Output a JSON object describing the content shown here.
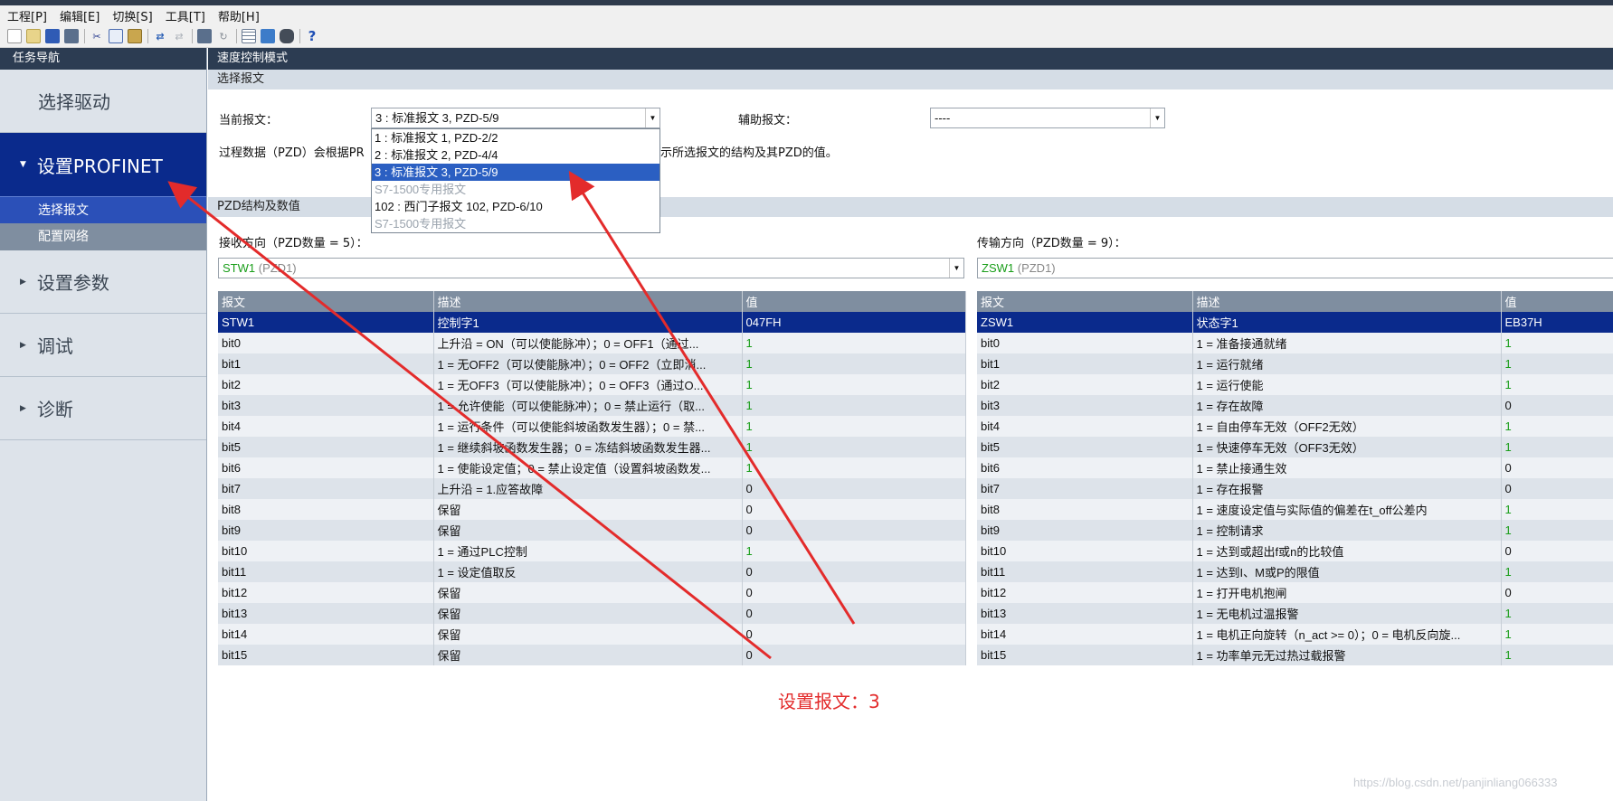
{
  "menu": [
    "工程[P]",
    "编辑[E]",
    "切换[S]",
    "工具[T]",
    "帮助[H]"
  ],
  "toolbar_icons": [
    "new-icon",
    "open-icon",
    "save-icon",
    "print-icon",
    "cut-icon",
    "copy-icon",
    "paste-icon",
    "connect-icon",
    "disconnect-icon",
    "download-icon",
    "upload-icon",
    "table-icon",
    "chart-icon",
    "device-icon",
    "help-icon"
  ],
  "nav": {
    "header": "任务导航",
    "items": [
      {
        "label": "选择驱动"
      },
      {
        "label": "设置PROFINET"
      },
      {
        "label": "设置参数"
      },
      {
        "label": "调试"
      },
      {
        "label": "诊断"
      }
    ],
    "subitems": [
      "选择报文",
      "配置网络"
    ]
  },
  "main": {
    "title": "速度控制模式",
    "section1": "选择报文",
    "current_label": "当前报文：",
    "current_value": "3 : 标准报文 3, PZD-5/9",
    "aux_label": "辅助报文：",
    "aux_value": "----",
    "description_left": "过程数据（PZD）会根据PR",
    "description_right": "示所选报文的结构及其PZD的值。",
    "section2": "PZD结构及数值",
    "dropdown_options": [
      "1 : 标准报文 1, PZD-2/2",
      "2 : 标准报文 2, PZD-4/4",
      "3 : 标准报文 3, PZD-5/9",
      "S7-1500专用报文",
      "102 : 西门子报文 102, PZD-6/10",
      "S7-1500专用报文"
    ]
  },
  "receive": {
    "label": "接收方向（PZD数量 = 5）：",
    "combo_name": "STW1",
    "combo_suffix": " (PZD1)",
    "headers": [
      "报文",
      "描述",
      "值"
    ],
    "rows": [
      [
        "STW1",
        "控制字1",
        "047FH"
      ],
      [
        "bit0",
        "上升沿 = ON（可以使能脉冲）；0 = OFF1（通过...",
        "1"
      ],
      [
        "bit1",
        "1 = 无OFF2（可以使能脉冲）；0 = OFF2（立即消...",
        "1"
      ],
      [
        "bit2",
        "1 = 无OFF3（可以使能脉冲）；0 = OFF3（通过O...",
        "1"
      ],
      [
        "bit3",
        "1 = 允许使能（可以使能脉冲）；0 = 禁止运行（取...",
        "1"
      ],
      [
        "bit4",
        "1 = 运行条件（可以使能斜坡函数发生器）；0 = 禁...",
        "1"
      ],
      [
        "bit5",
        "1 = 继续斜坡函数发生器；0 = 冻结斜坡函数发生器...",
        "1"
      ],
      [
        "bit6",
        "1 = 使能设定值；0 = 禁止设定值（设置斜坡函数发...",
        "1"
      ],
      [
        "bit7",
        "上升沿 = 1.应答故障",
        "0"
      ],
      [
        "bit8",
        "保留",
        "0"
      ],
      [
        "bit9",
        "保留",
        "0"
      ],
      [
        "bit10",
        "1 = 通过PLC控制",
        "1"
      ],
      [
        "bit11",
        "1 = 设定值取反",
        "0"
      ],
      [
        "bit12",
        "保留",
        "0"
      ],
      [
        "bit13",
        "保留",
        "0"
      ],
      [
        "bit14",
        "保留",
        "0"
      ],
      [
        "bit15",
        "保留",
        "0"
      ]
    ]
  },
  "transmit": {
    "label": "传输方向（PZD数量 = 9）：",
    "combo_name": "ZSW1",
    "combo_suffix": " (PZD1)",
    "headers": [
      "报文",
      "描述",
      "值"
    ],
    "rows": [
      [
        "ZSW1",
        "状态字1",
        "EB37H"
      ],
      [
        "bit0",
        "1 = 准备接通就绪",
        "1"
      ],
      [
        "bit1",
        "1 = 运行就绪",
        "1"
      ],
      [
        "bit2",
        "1 = 运行使能",
        "1"
      ],
      [
        "bit3",
        "1 = 存在故障",
        "0"
      ],
      [
        "bit4",
        "1 = 自由停车无效（OFF2无效）",
        "1"
      ],
      [
        "bit5",
        "1 = 快速停车无效（OFF3无效）",
        "1"
      ],
      [
        "bit6",
        "1 = 禁止接通生效",
        "0"
      ],
      [
        "bit7",
        "1 = 存在报警",
        "0"
      ],
      [
        "bit8",
        "1 = 速度设定值与实际值的偏差在t_off公差内",
        "1"
      ],
      [
        "bit9",
        "1 = 控制请求",
        "1"
      ],
      [
        "bit10",
        "1 = 达到或超出f或n的比较值",
        "0"
      ],
      [
        "bit11",
        "1 = 达到I、M或P的限值",
        "1"
      ],
      [
        "bit12",
        "1 = 打开电机抱闸",
        "0"
      ],
      [
        "bit13",
        "1 = 无电机过温报警",
        "1"
      ],
      [
        "bit14",
        "1 = 电机正向旋转（n_act >= 0）；0 = 电机反向旋...",
        "1"
      ],
      [
        "bit15",
        "1 = 功率单元无过热过载报警",
        "1"
      ]
    ]
  },
  "annotation": "设置报文：3",
  "watermark": "https://blog.csdn.net/panjinliang066333",
  "colors": {
    "nav_active": "#0a2a8c",
    "highlight_row": "#0a2a8c",
    "value_one_green": "#1a9e1a",
    "annotation_red": "#e32b2b"
  }
}
